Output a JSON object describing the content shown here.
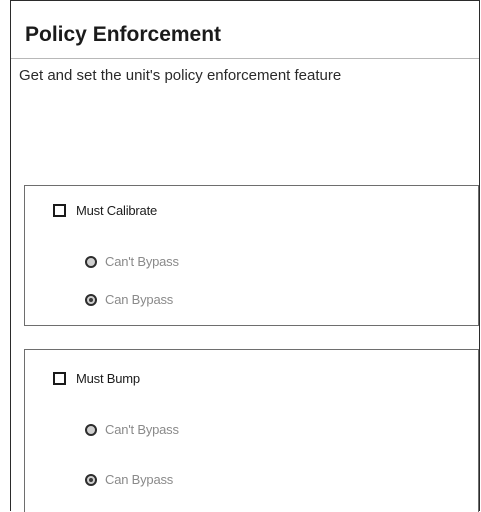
{
  "header": {
    "title": "Policy Enforcement",
    "subtitle": "Get and set the unit's policy enforcement feature"
  },
  "groups": [
    {
      "checkbox_label": "Must Calibrate",
      "checked": false,
      "options": [
        {
          "label": "Can't Bypass",
          "selected": false
        },
        {
          "label": "Can Bypass",
          "selected": true
        }
      ]
    },
    {
      "checkbox_label": "Must Bump",
      "checked": false,
      "options": [
        {
          "label": "Can't Bypass",
          "selected": false
        },
        {
          "label": "Can Bypass",
          "selected": true
        }
      ]
    }
  ],
  "colors": {
    "title_text": "#1b1b1b",
    "disabled_text": "#8a8a8a",
    "group_border": "#6e6e6e"
  }
}
